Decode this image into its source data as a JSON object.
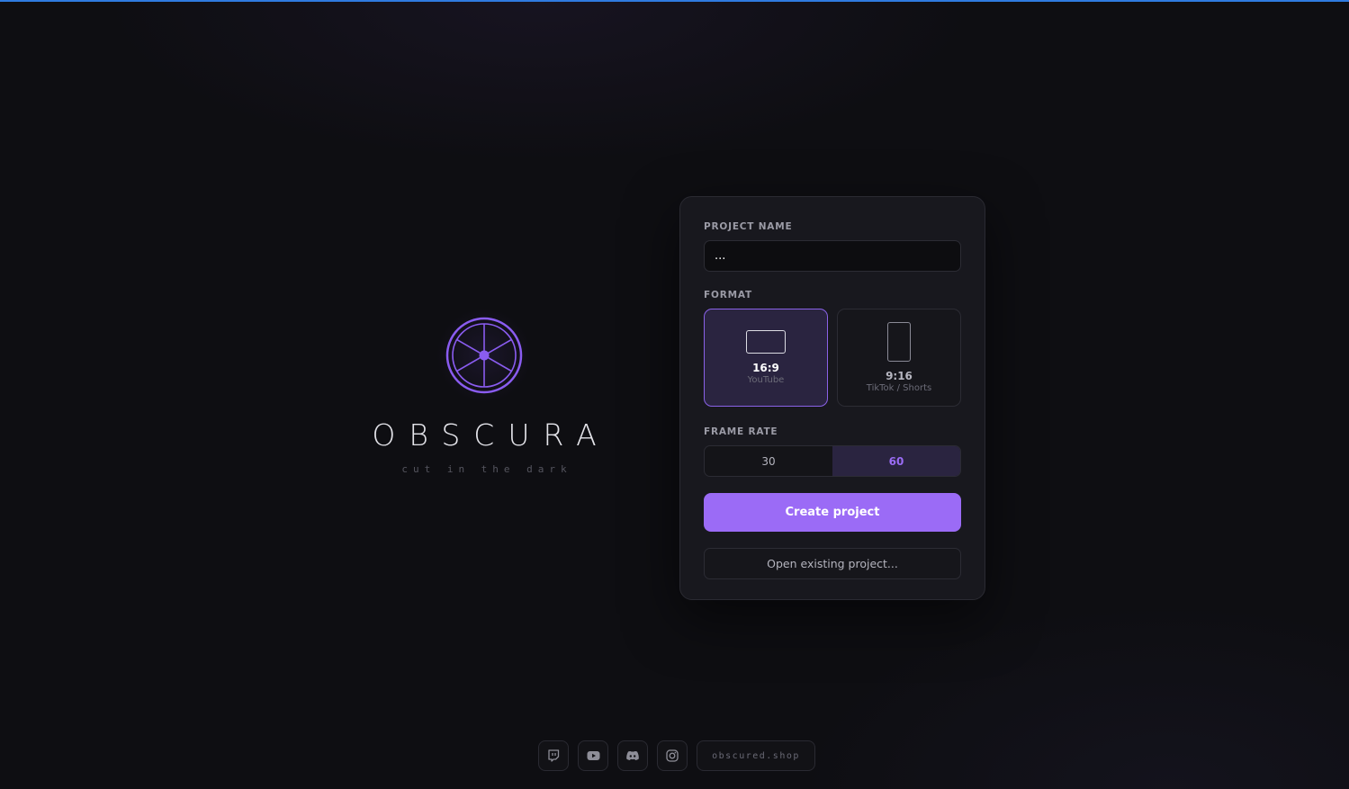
{
  "brand": {
    "title": "OBSCURA",
    "tagline": "cut in the dark",
    "logo_icon": "aperture-wheel-icon",
    "accent_color": "#8a5cf0"
  },
  "form": {
    "project_name_label": "PROJECT NAME",
    "project_name_value": "...",
    "format_label": "FORMAT",
    "formats": [
      {
        "ratio": "16:9",
        "platform": "YouTube",
        "selected": true
      },
      {
        "ratio": "9:16",
        "platform": "TikTok / Shorts",
        "selected": false
      }
    ],
    "frame_rate_label": "FRAME RATE",
    "frame_rates": [
      {
        "value": "30",
        "selected": false
      },
      {
        "value": "60",
        "selected": true
      }
    ],
    "create_label": "Create project",
    "open_label": "Open existing project..."
  },
  "footer": {
    "socials": [
      "twitch-icon",
      "youtube-icon",
      "discord-icon",
      "instagram-icon"
    ],
    "site": "obscured.shop"
  },
  "colors": {
    "background": "#0e0e12",
    "card": "#18181e",
    "primary_button": "#9b6bf6",
    "selected_bg": "#2a2440",
    "top_bar": "#2f7be0"
  }
}
